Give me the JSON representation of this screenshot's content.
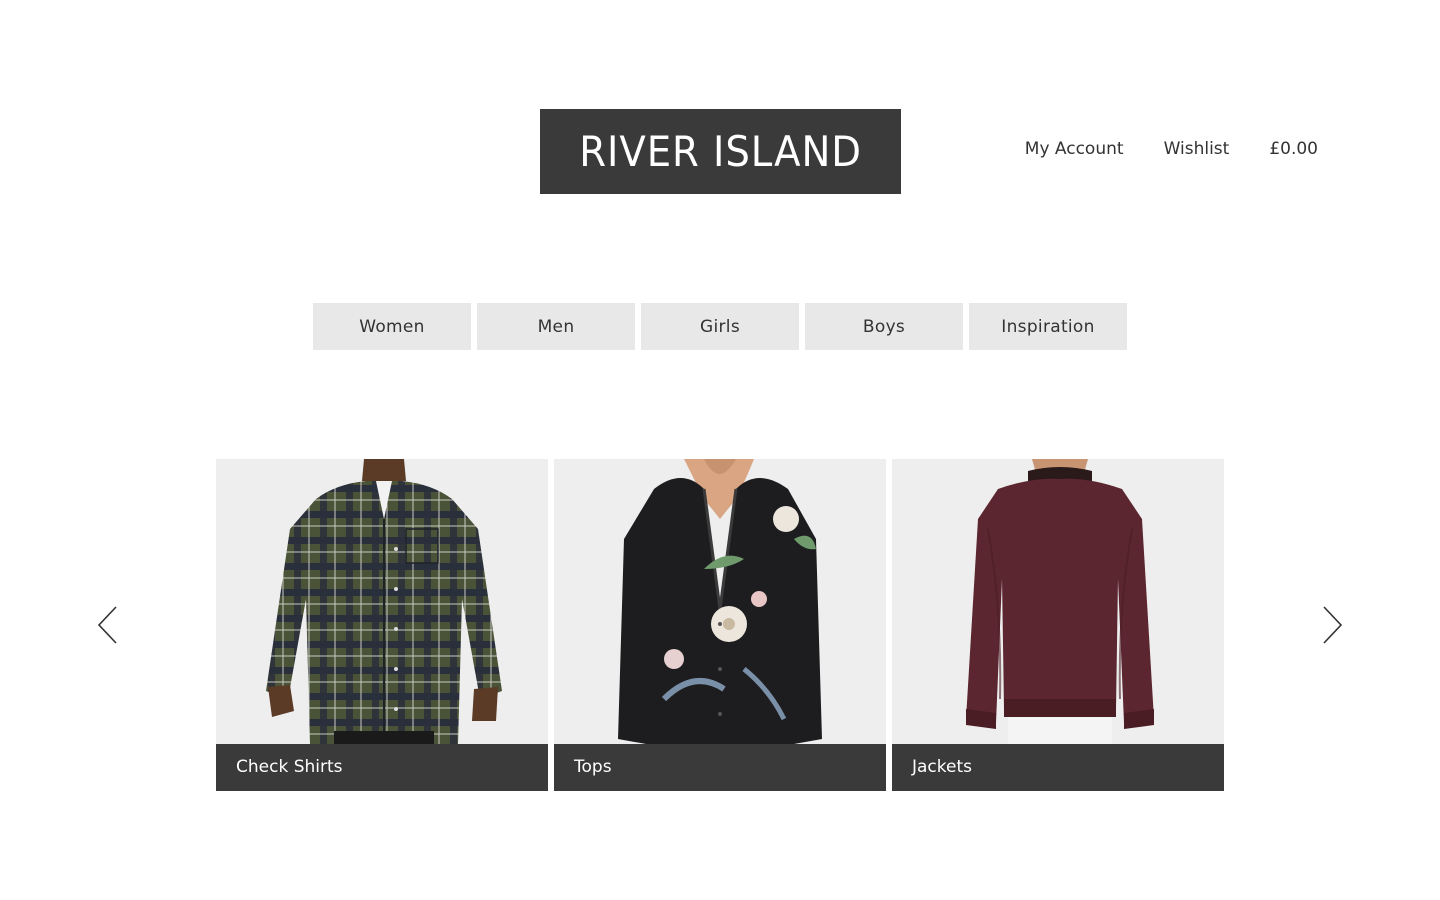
{
  "header": {
    "logo_text": "RIVER ISLAND",
    "account_nav": [
      "My Account",
      "Wishlist",
      "£0.00"
    ]
  },
  "categories": [
    "Women",
    "Men",
    "Girls",
    "Boys",
    "Inspiration"
  ],
  "carousel": {
    "prev_icon": "chevron-left-icon",
    "next_icon": "chevron-right-icon",
    "cards": [
      {
        "label": "Check Shirts"
      },
      {
        "label": "Tops"
      },
      {
        "label": "Jackets"
      }
    ]
  },
  "colors": {
    "logo_bg": "#3a3a3a",
    "nav_bg": "#e8e8e8",
    "card_label_bg": "#3a3a3a"
  }
}
